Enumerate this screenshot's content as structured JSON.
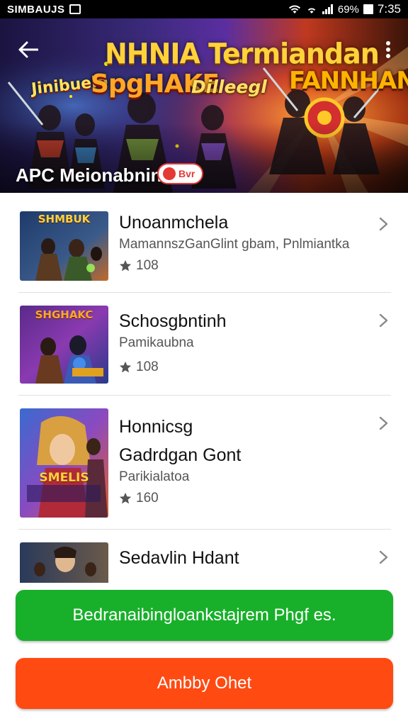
{
  "status_bar": {
    "carrier": "SIMBAUJS",
    "battery": "69%",
    "time": "7:35"
  },
  "hero": {
    "title": "NHNIA Termiandan",
    "logos": [
      "Jinibuelb",
      "SpgHAKE",
      "Dilleegl",
      "FANNHAN"
    ],
    "subtitle": "APC Meionabnin",
    "badge_text": "Bvr"
  },
  "games": [
    {
      "title": "Unoanmchela",
      "subtitle": "MamannszGanGlint gbam, Pnlmiantka",
      "rating": "108",
      "thumb_text": "SHMBUK"
    },
    {
      "title": "Schosgbntinh",
      "subtitle": "Pamikaubna",
      "rating": "108",
      "thumb_text": "SHGHAKC"
    },
    {
      "title": "Honnicsg",
      "title_line2": "Gadrdgan Gont",
      "subtitle": "Parikialatoa",
      "rating": "160",
      "thumb_text": "SMELIS"
    },
    {
      "title": "Sedavlin Hdant"
    }
  ],
  "buttons": {
    "primary": "Bedranaibingloankstajrem Phgf es.",
    "secondary": "Ambby Ohet"
  },
  "colors": {
    "primary_button": "#18b02a",
    "secondary_button": "#ff4a12",
    "hero_title": "#ffd23a"
  },
  "icons": [
    "back-arrow",
    "more-vert",
    "star",
    "chevron-right"
  ]
}
